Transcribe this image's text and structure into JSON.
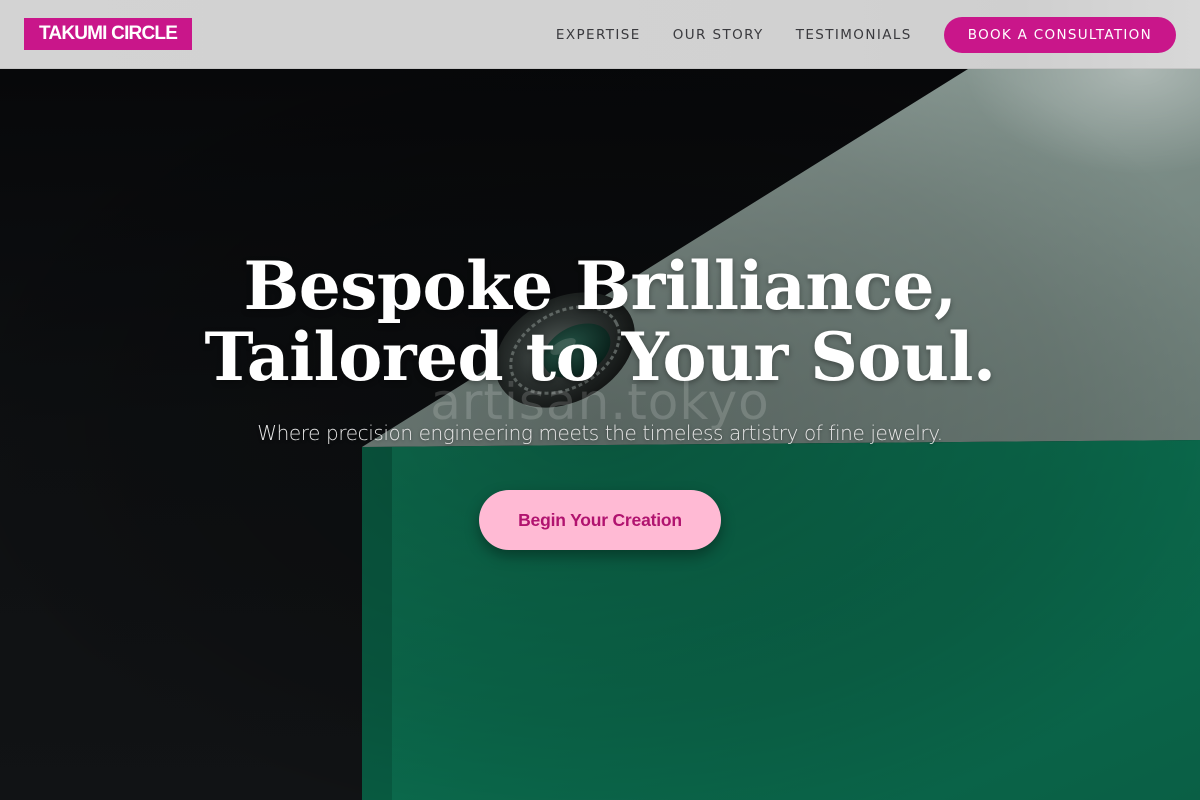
{
  "header": {
    "logo_text": "TAKUMI CIRCLE",
    "nav": [
      {
        "label": "EXPERTISE"
      },
      {
        "label": "OUR STORY"
      },
      {
        "label": "TESTIMONIALS"
      }
    ],
    "cta_label": "BOOK A CONSULTATION"
  },
  "hero": {
    "title_line1": "Bespoke Brilliance,",
    "title_line2": "Tailored to Your Soul.",
    "subtitle": "Where precision engineering meets the timeless artistry of fine jewelry.",
    "cta_label": "Begin Your Creation",
    "watermark": "artisan.tokyo"
  },
  "colors": {
    "brand_magenta": "#c9168a",
    "cta_pink": "#ffbad4",
    "cta_text": "#b1136f",
    "header_bg": "#d3d3d3",
    "hero_dark": "#0b0b0d",
    "hero_green": "#0b6e50",
    "hero_grey": "#8a9b96"
  }
}
